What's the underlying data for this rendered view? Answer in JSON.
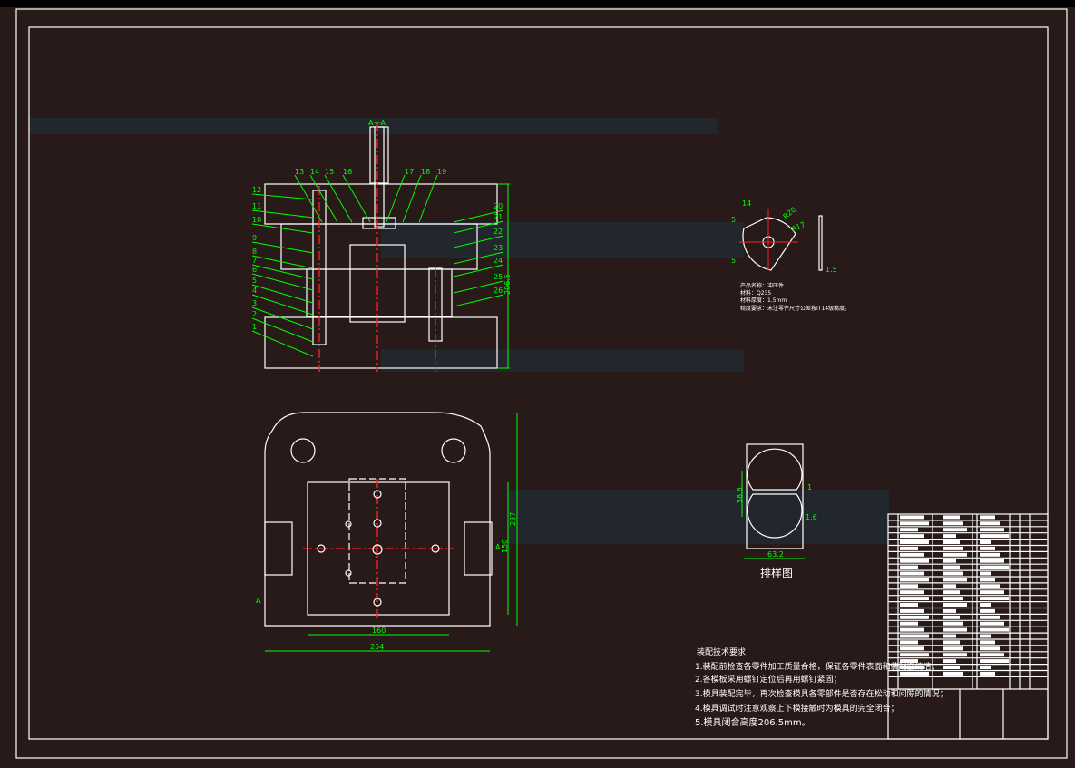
{
  "section_view": {
    "title": "A—A",
    "part_labels_left": [
      "12",
      "11",
      "10",
      "9",
      "8",
      "7",
      "6",
      "5",
      "4",
      "3",
      "2",
      "1"
    ],
    "part_labels_top": [
      "13",
      "14",
      "15",
      "16",
      "17",
      "18",
      "19"
    ],
    "part_labels_right": [
      "20",
      "21",
      "22",
      "23",
      "24",
      "25",
      "26"
    ],
    "height_dim": "206.5"
  },
  "plan_view": {
    "section_mark": "A",
    "dim_inner_width": "160",
    "dim_outer_width": "254",
    "dim_outer_height": "237",
    "dim_inner_height": "150"
  },
  "part_drawing": {
    "dim_top": "14",
    "dim_radius_1": "R20",
    "dim_radius_2": "R17",
    "dim_left_1": "5",
    "dim_left_2": "5",
    "thickness": "1.5",
    "info": [
      "产品名称：冲压件",
      "材料：Q235",
      "材料厚度：1.5mm",
      "精度要求：未注零件尺寸公差按IT14级精度。"
    ]
  },
  "strip_layout": {
    "title": "排样图",
    "pitch": "58.8",
    "gap_1": "1",
    "gap_2": "1.6",
    "width": "63.2"
  },
  "tech_requirements": {
    "title": "装配技术要求",
    "items": [
      "1.装配前检查各零件加工质量合格，保证各零件表面和装配面清洁；",
      "2.各模板采用螺钉定位后再用螺钉紧固；",
      "3.模具装配完毕，再次检查模具各零部件是否存在松动和间隙的情况；",
      "4.模具调试时注意观察上下模接触时为模具的完全闭合；",
      "5.模具闭合高度206.5mm。"
    ]
  },
  "colors": {
    "background": "#281a18",
    "line": "#ffffff",
    "dimension": "#00ff00",
    "centerline": "#ff2020"
  }
}
